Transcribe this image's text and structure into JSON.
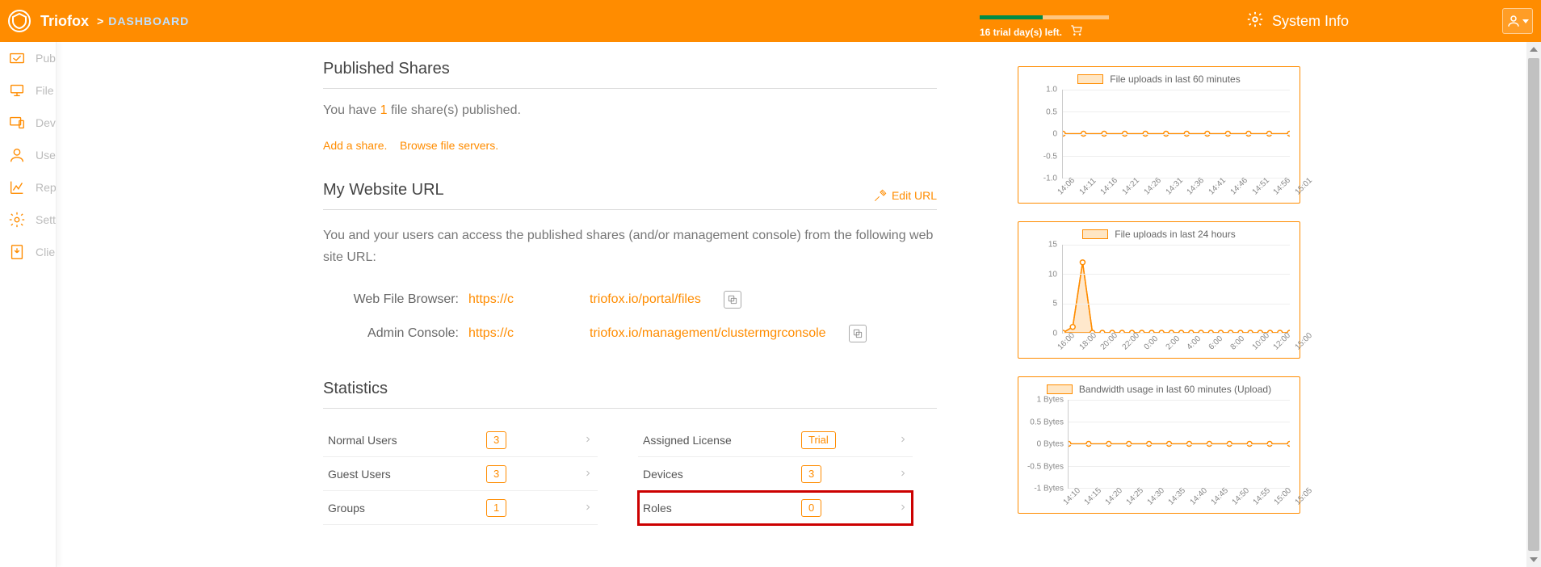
{
  "header": {
    "brand": "Triofox",
    "crumb_separator": ">",
    "crumb_page": "DASHBOARD",
    "trial_text": "16 trial day(s) left.",
    "system_info": "System Info"
  },
  "sidebar": {
    "items": [
      {
        "label": "Published Shares"
      },
      {
        "label": "File Servers"
      },
      {
        "label": "Devices"
      },
      {
        "label": "Users"
      },
      {
        "label": "Reports"
      },
      {
        "label": "Settings"
      },
      {
        "label": "Client Download"
      }
    ]
  },
  "published_shares": {
    "title": "Published Shares",
    "prefix": "You have ",
    "count": "1",
    "suffix": " file share(s) published.",
    "add_share": "Add a share.",
    "browse": "Browse file servers."
  },
  "website_url": {
    "title": "My Website URL",
    "edit": "Edit URL",
    "description": "You and your users can access the published shares (and/or management console) from the following web site URL:",
    "rows": [
      {
        "label": "Web File Browser:",
        "input": "https://c",
        "rest": "triofox.io/portal/files"
      },
      {
        "label": "Admin Console:",
        "input": "https://c",
        "rest": "triofox.io/management/clustermgrconsole"
      }
    ]
  },
  "statistics": {
    "title": "Statistics",
    "left": [
      {
        "label": "Normal Users",
        "value": "3"
      },
      {
        "label": "Guest Users",
        "value": "3"
      },
      {
        "label": "Groups",
        "value": "1"
      }
    ],
    "right": [
      {
        "label": "Assigned License",
        "value": "Trial"
      },
      {
        "label": "Devices",
        "value": "3"
      },
      {
        "label": "Roles",
        "value": "0",
        "highlight": true
      }
    ]
  },
  "chart_data": [
    {
      "type": "line",
      "title": "File uploads in last 60 minutes",
      "ylim": [
        -1.0,
        1.0
      ],
      "yticks": [
        "1.0",
        "0.5",
        "0",
        "-0.5",
        "-1.0"
      ],
      "categories": [
        "14:06",
        "14:11",
        "14:16",
        "14:21",
        "14:26",
        "14:31",
        "14:36",
        "14:41",
        "14:46",
        "14:51",
        "14:56",
        "15:01"
      ],
      "values": [
        0,
        0,
        0,
        0,
        0,
        0,
        0,
        0,
        0,
        0,
        0,
        0
      ]
    },
    {
      "type": "line",
      "title": "File uploads in last 24 hours",
      "ylim": [
        0,
        15
      ],
      "yticks": [
        "15",
        "10",
        "5",
        "0"
      ],
      "categories": [
        "16:00",
        "18:00",
        "20:00",
        "22:00",
        "0:00",
        "2:00",
        "4:00",
        "6:00",
        "8:00",
        "10:00",
        "12:00",
        "15:00"
      ],
      "values": [
        0,
        1,
        12,
        0,
        0,
        0,
        0,
        0,
        0,
        0,
        0,
        0,
        0,
        0,
        0,
        0,
        0,
        0,
        0,
        0,
        0,
        0,
        0,
        0
      ]
    },
    {
      "type": "line",
      "title": "Bandwidth usage in last 60 minutes (Upload)",
      "ylim": [
        -1,
        1
      ],
      "yticks": [
        "1 Bytes",
        "0.5 Bytes",
        "0 Bytes",
        "-0.5 Bytes",
        "-1 Bytes"
      ],
      "categories": [
        "14:10",
        "14:15",
        "14:20",
        "14:25",
        "14:30",
        "14:35",
        "14:40",
        "14:45",
        "14:50",
        "14:55",
        "15:00",
        "15:05"
      ],
      "values": [
        0,
        0,
        0,
        0,
        0,
        0,
        0,
        0,
        0,
        0,
        0,
        0
      ]
    }
  ]
}
